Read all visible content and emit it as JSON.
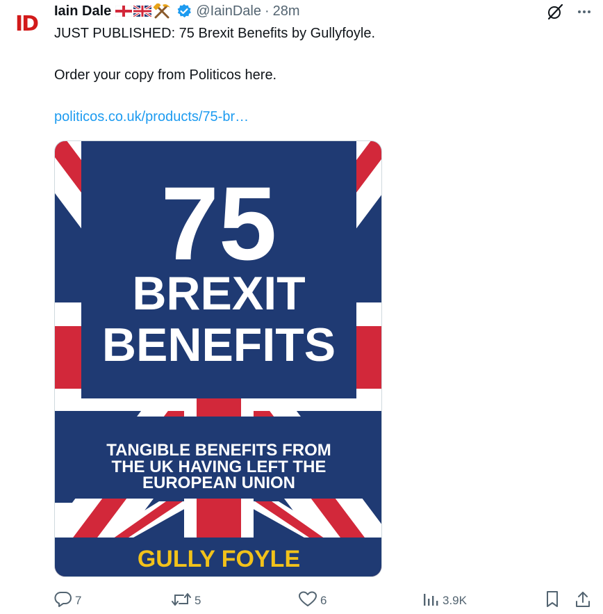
{
  "tweet": {
    "avatar_text": "ID",
    "display_name": "Iain Dale",
    "handle": "@IainDale",
    "separator": "·",
    "time": "28m",
    "lines": [
      "JUST PUBLISHED: 75 Brexit Benefits by Gullyfoyle.",
      "Order your copy from Politicos here."
    ],
    "link": "politicos.co.uk/products/75-br…"
  },
  "book_cover": {
    "number": "75",
    "title_line1": "BREXIT",
    "title_line2": "BENEFITS",
    "subtitle_line1": "TANGIBLE BENEFITS FROM",
    "subtitle_line2": "THE UK HAVING LEFT THE",
    "subtitle_line3": "EUROPEAN UNION",
    "author": "GULLY FOYLE",
    "colors": {
      "blue": "#1f3a73",
      "red": "#d2283a",
      "white": "#ffffff",
      "yellow": "#f2c21a"
    }
  },
  "actions": {
    "replies": "7",
    "reposts": "5",
    "likes": "6",
    "views": "3.9K"
  },
  "icons": [
    "grok-icon",
    "more-icon",
    "reply-icon",
    "repost-icon",
    "like-icon",
    "views-icon",
    "bookmark-icon",
    "share-icon",
    "verified-icon",
    "england-flag-icon",
    "uk-flag-icon",
    "hammer-pick-icon"
  ]
}
